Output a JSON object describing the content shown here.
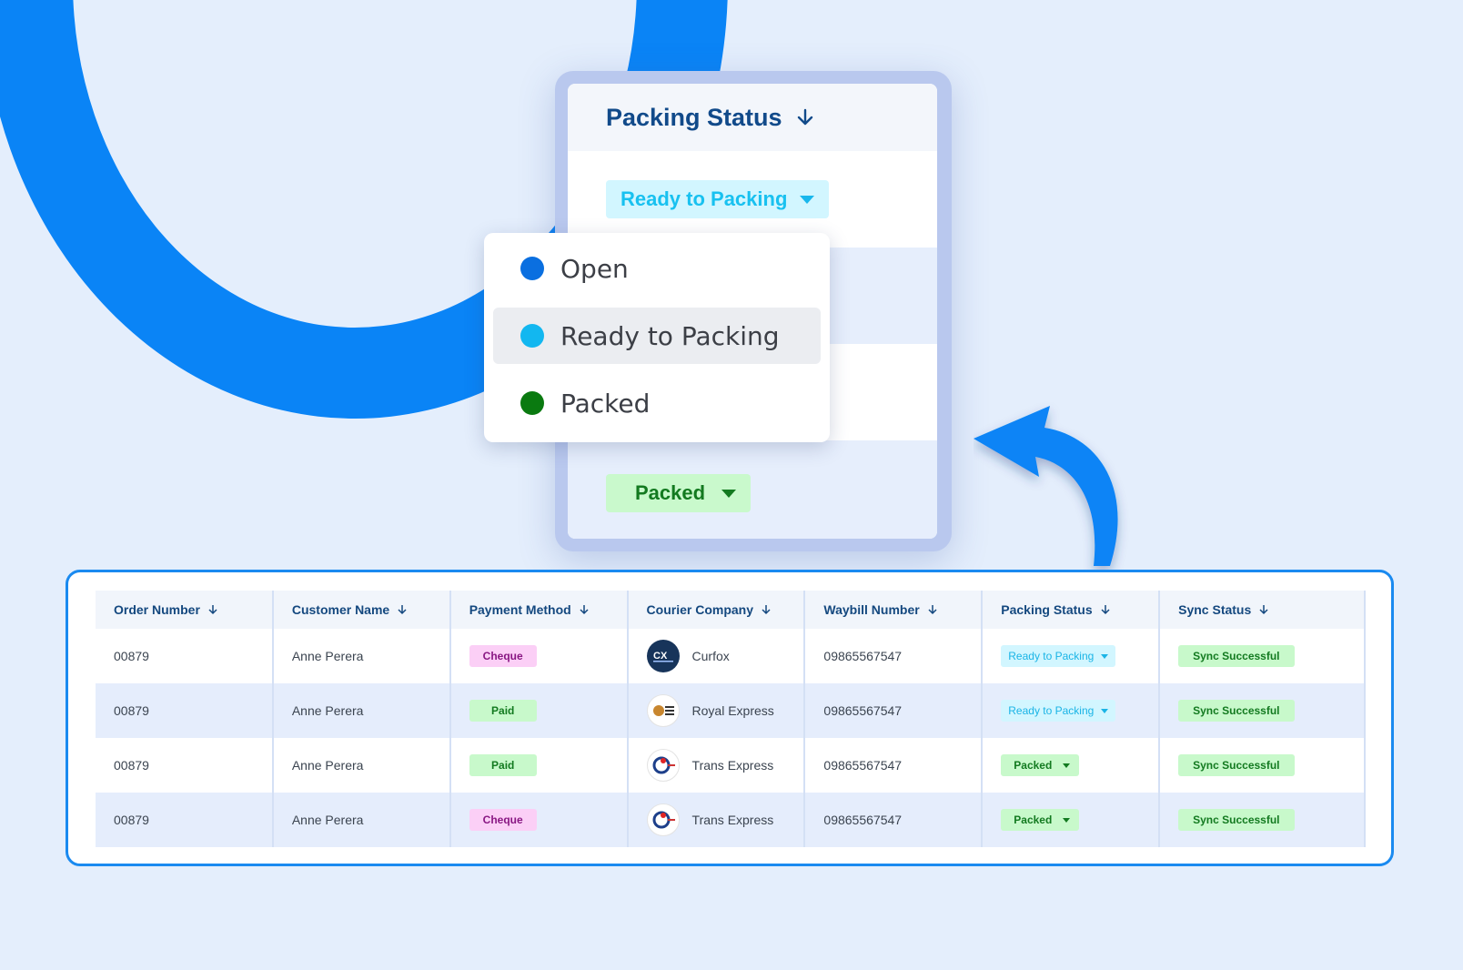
{
  "zoom_card": {
    "header": "Packing Status",
    "selected_pill": "Ready to Packing",
    "bottom_pill": "Packed"
  },
  "dropdown": {
    "options": [
      {
        "label": "Open",
        "color": "#0a6fe0"
      },
      {
        "label": "Ready to Packing",
        "color": "#12b7f0"
      },
      {
        "label": "Packed",
        "color": "#0a7a10"
      }
    ]
  },
  "table": {
    "columns": [
      "Order Number",
      "Customer Name",
      "Payment Method",
      "Courier Company",
      "Waybill Number",
      "Packing Status",
      "Sync Status"
    ],
    "rows": [
      {
        "order": "00879",
        "customer": "Anne Perera",
        "payment": "Cheque",
        "courier": "Curfox",
        "courier_logo": "curfox-logo",
        "waybill": "09865567547",
        "packing": "Ready to Packing",
        "sync": "Sync Successful"
      },
      {
        "order": "00879",
        "customer": "Anne Perera",
        "payment": "Paid",
        "courier": "Royal Express",
        "courier_logo": "royal-express-logo",
        "waybill": "09865567547",
        "packing": "Ready to Packing",
        "sync": "Sync Successful"
      },
      {
        "order": "00879",
        "customer": "Anne Perera",
        "payment": "Paid",
        "courier": "Trans Express",
        "courier_logo": "trans-express-logo",
        "waybill": "09865567547",
        "packing": "Packed",
        "sync": "Sync Successful"
      },
      {
        "order": "00879",
        "customer": "Anne Perera",
        "payment": "Cheque",
        "courier": "Trans Express",
        "courier_logo": "trans-express-logo",
        "waybill": "09865567547",
        "packing": "Packed",
        "sync": "Sync Successful"
      }
    ]
  },
  "colors": {
    "accent": "#0a84f6",
    "header_text": "#14487f",
    "cheque_bg": "#fbcff6",
    "paid_bg": "#c8f9cb",
    "ready_bg": "#d2f6ff"
  }
}
